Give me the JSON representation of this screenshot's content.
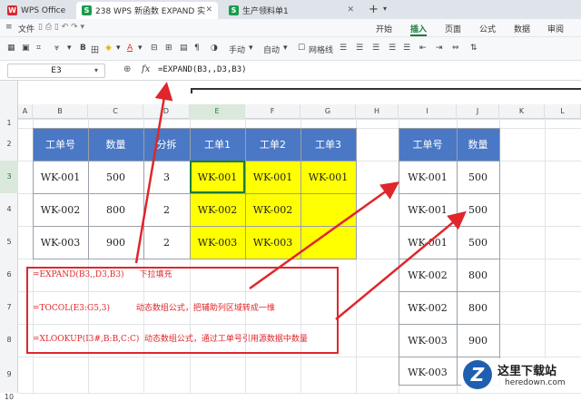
{
  "titlebar": {
    "tabs": [
      {
        "label": "WPS Office",
        "icon": "wps-logo-icon"
      },
      {
        "label": "238 WPS 新函数 EXPAND 实",
        "icon": "sheet-s-icon"
      },
      {
        "label": "生产领料单1",
        "icon": "sheet-s-icon"
      }
    ],
    "new_tab": "+"
  },
  "menubar": {
    "file": "文件",
    "items": [
      "开始",
      "插入",
      "页面",
      "公式",
      "数据",
      "审阅"
    ],
    "active": "插入"
  },
  "toolbar": {
    "font_name": "手动",
    "auto": "自动",
    "gridlines": "网格线"
  },
  "formula_bar": {
    "name_box": "E3",
    "fx": "fx",
    "formula": "=EXPAND(B3,,D3,B3)"
  },
  "columns": [
    "A",
    "B",
    "C",
    "D",
    "E",
    "F",
    "G",
    "H",
    "I",
    "J",
    "K",
    "L"
  ],
  "rows": [
    "1",
    "2",
    "3",
    "4",
    "5",
    "6",
    "7",
    "8",
    "9",
    "10"
  ],
  "outline_levels": [
    "1",
    "2"
  ],
  "left_table": {
    "headers": [
      "工单号",
      "数量",
      "分拆",
      "工单1",
      "工单2",
      "工单3"
    ],
    "rows": [
      [
        "WK-001",
        "500",
        "3",
        "WK-001",
        "WK-001",
        "WK-001"
      ],
      [
        "WK-002",
        "800",
        "2",
        "WK-002",
        "WK-002",
        ""
      ],
      [
        "WK-003",
        "900",
        "2",
        "WK-003",
        "WK-003",
        ""
      ]
    ]
  },
  "right_table": {
    "headers": [
      "工单号",
      "数量"
    ],
    "rows": [
      [
        "WK-001",
        "500"
      ],
      [
        "WK-001",
        "500"
      ],
      [
        "WK-001",
        "500"
      ],
      [
        "WK-002",
        "800"
      ],
      [
        "WK-002",
        "800"
      ],
      [
        "WK-003",
        "900"
      ],
      [
        "WK-003",
        "900"
      ]
    ]
  },
  "notes": [
    {
      "formula": "=EXPAND(B3,,D3,B3)",
      "text": "下拉填充"
    },
    {
      "formula": "=TOCOL(E3:G5,3)",
      "text": "动态数组公式，把辅助列区域转成一维"
    },
    {
      "formula": "=XLOOKUP(I3#,B:B,C:C)",
      "text": "动态数组公式，通过工单号引用源数据中数量"
    }
  ],
  "watermark": {
    "title": "这里下载站",
    "url": "heredown.com"
  },
  "colors": {
    "header_blue": "#4a78c4",
    "highlight_yellow": "#ffff00",
    "annotation_red": "#e0262b",
    "accent_green": "#1a7d3b"
  }
}
